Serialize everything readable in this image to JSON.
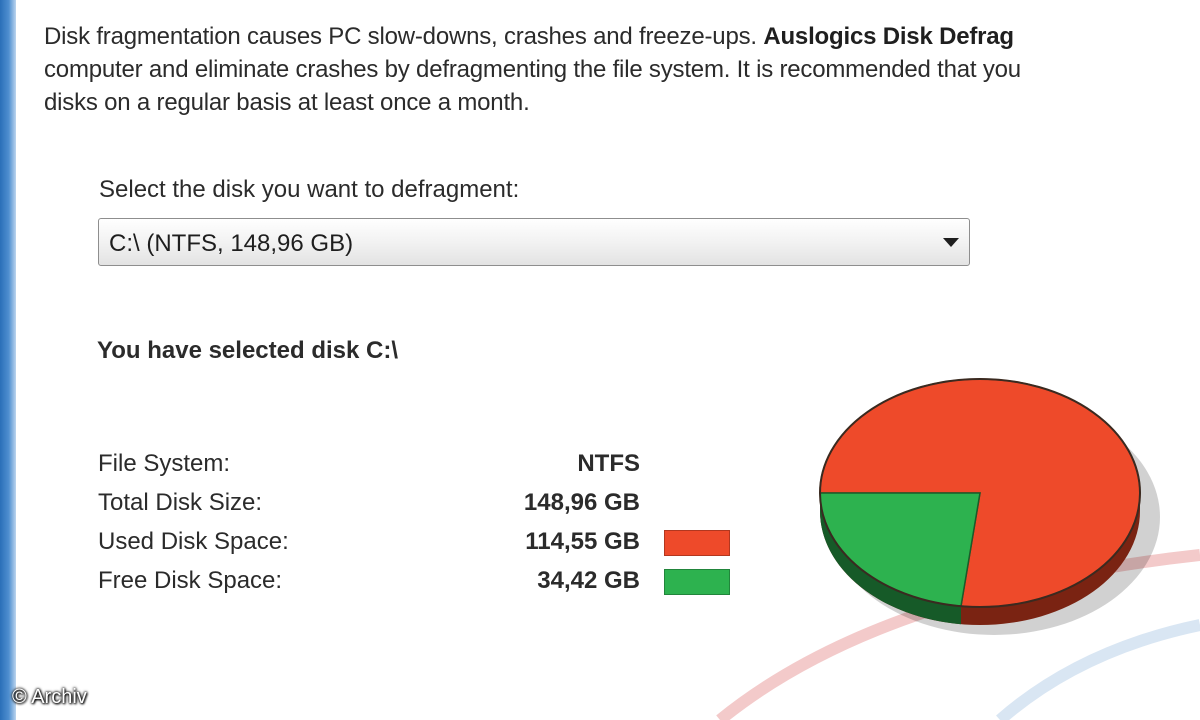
{
  "intro": {
    "line1_prefix": "Disk fragmentation causes PC slow-downs, crashes and freeze-ups. ",
    "line1_brand": "Auslogics Disk Defrag",
    "line2": "computer and eliminate crashes by defragmenting the file system. It is recommended that you",
    "line3": "disks on a regular basis at least once a month."
  },
  "disk_select": {
    "label": "Select the disk you want to defragment:",
    "value": "C:\\ (NTFS, 148,96 GB)"
  },
  "selected_heading": "You have selected disk C:\\",
  "disk_info": {
    "file_system": {
      "label": "File System:",
      "value": "NTFS"
    },
    "total_size": {
      "label": "Total Disk Size:",
      "value": "148,96 GB"
    },
    "used_space": {
      "label": "Used Disk Space:",
      "value": "114,55 GB"
    },
    "free_space": {
      "label": "Free Disk Space:",
      "value": "34,42 GB"
    }
  },
  "colors": {
    "used": "#ee4a2a",
    "used_dark": "#7a2312",
    "free": "#2db24f",
    "free_dark": "#165a28"
  },
  "icons": {
    "dropdown": "triangle-down-icon"
  },
  "chart_data": {
    "type": "pie",
    "categories": [
      "Used Disk Space",
      "Free Disk Space"
    ],
    "values": [
      114.55,
      34.42
    ],
    "unit": "GB",
    "legend": "left"
  },
  "watermark": "© Archiv"
}
